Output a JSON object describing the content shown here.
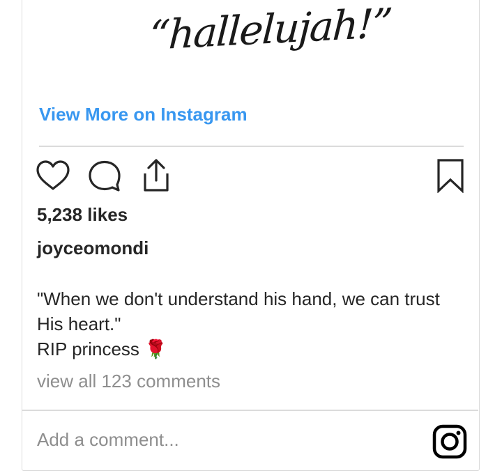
{
  "post": {
    "image_text": "“hallelujah!”",
    "view_more_link": "View More on Instagram",
    "likes": "5,238 likes",
    "username": "joyceomondi",
    "caption_lines": [
      "\"When we don't understand his hand, we can trust",
      "His heart.\"",
      "RIP princess 🌹"
    ],
    "view_comments": "view all 123 comments",
    "comment_placeholder": "Add a comment..."
  },
  "icons": {
    "like": "heart-icon",
    "comment": "comment-bubble-icon",
    "share": "share-icon",
    "save": "bookmark-icon",
    "brand": "instagram-logo-icon"
  },
  "colors": {
    "link": "#3897f0",
    "text": "#262626",
    "muted": "#8e8e8e",
    "border": "#dbdbdb"
  }
}
